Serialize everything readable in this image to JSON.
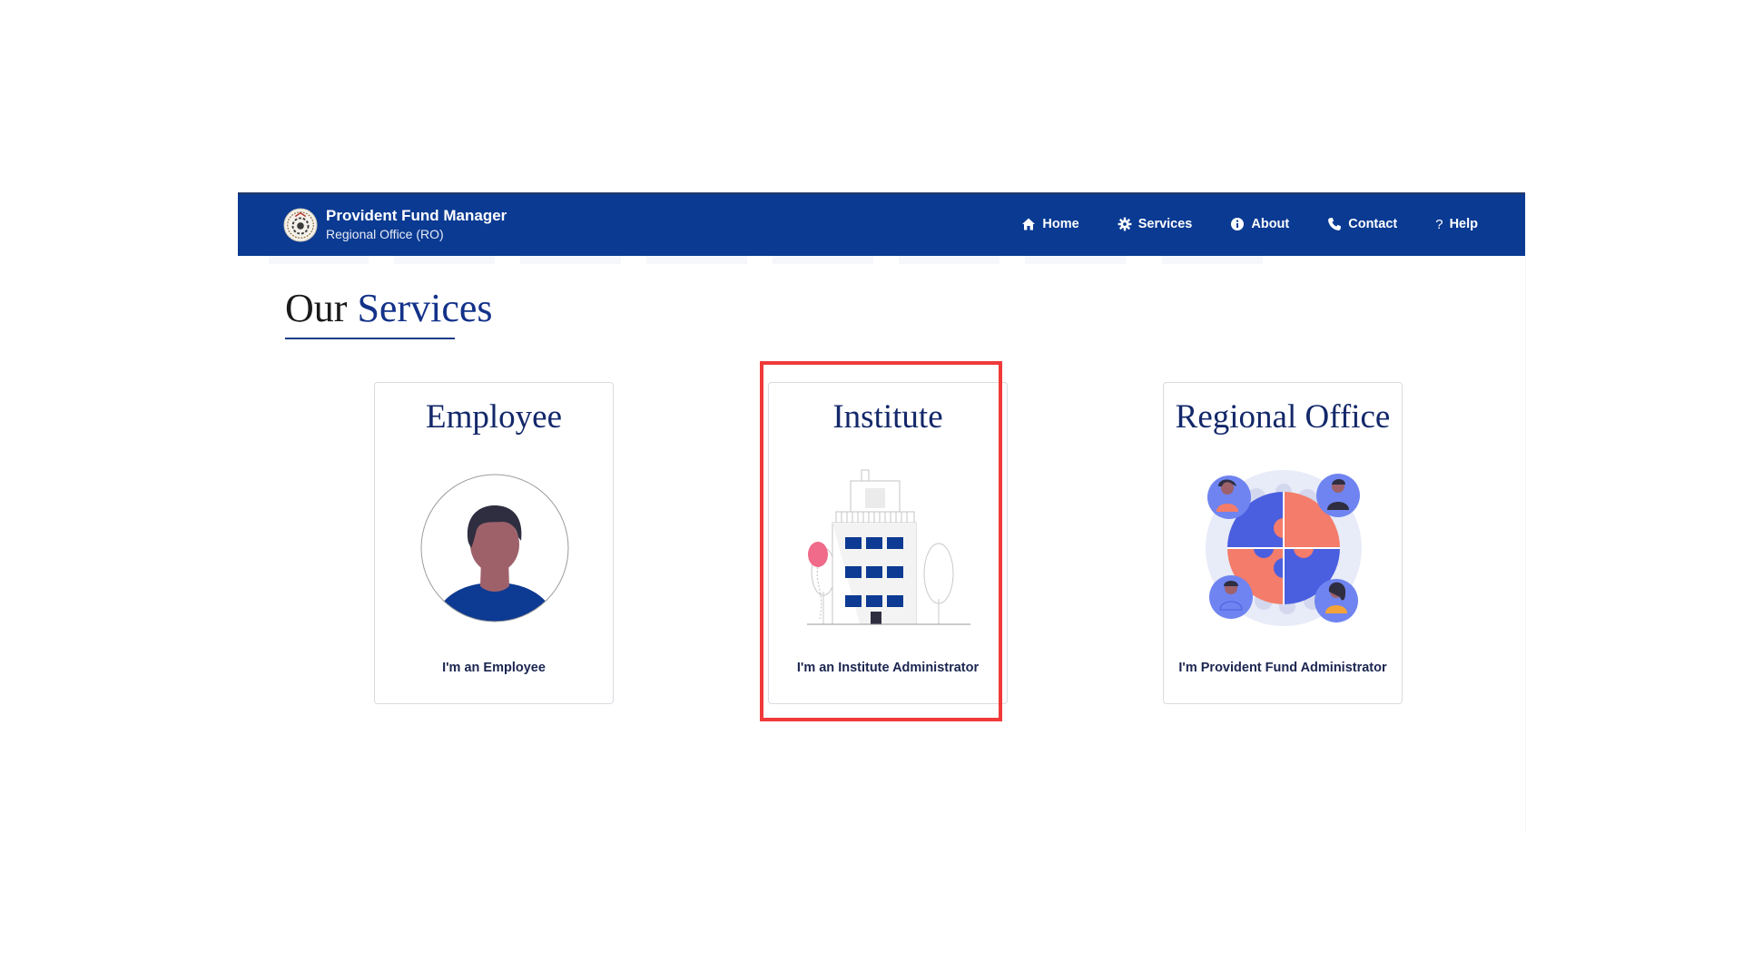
{
  "brand": {
    "title": "Provident Fund Manager",
    "subtitle": "Regional Office (RO)",
    "logo_icon": "emblem-icon"
  },
  "nav": {
    "items": [
      {
        "label": "Home",
        "icon": "home-icon"
      },
      {
        "label": "Services",
        "icon": "gear-icon"
      },
      {
        "label": "About",
        "icon": "info-icon"
      },
      {
        "label": "Contact",
        "icon": "phone-icon"
      },
      {
        "label": "Help",
        "icon": "question-icon",
        "glyph": "?"
      }
    ]
  },
  "section": {
    "title_plain": "Our",
    "title_accent": "Services"
  },
  "cards": [
    {
      "title": "Employee",
      "caption": "I'm an Employee",
      "art": "employee-avatar-illustration"
    },
    {
      "title": "Institute",
      "caption": "I'm an Institute Administrator",
      "art": "institute-building-illustration"
    },
    {
      "title": "Regional Office",
      "caption": "I'm Provident Fund Administrator",
      "art": "puzzle-team-illustration"
    }
  ],
  "colors": {
    "navbar": "#0a3a92",
    "title_accent": "#13328a",
    "card_title": "#13286a",
    "highlight": "#f03a3a"
  }
}
